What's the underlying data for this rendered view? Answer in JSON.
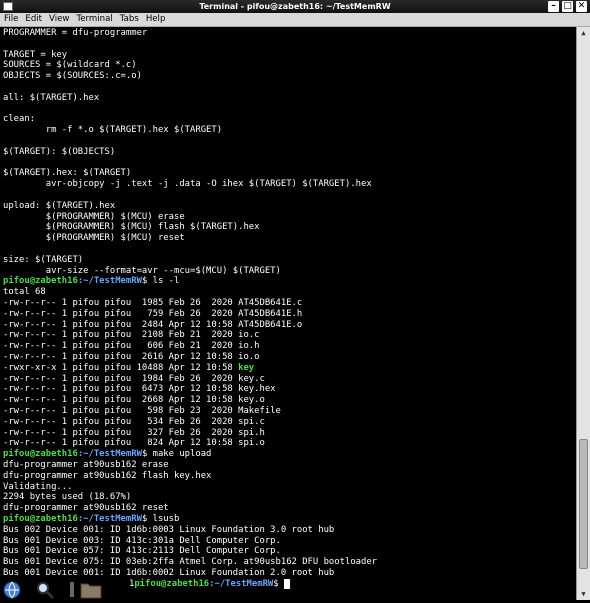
{
  "window": {
    "title": "Terminal - pifou@zabeth16: ~/TestMemRW",
    "buttons": {
      "minimize": "–",
      "maximize": "□",
      "close": "✕"
    }
  },
  "menu": [
    "File",
    "Edit",
    "View",
    "Terminal",
    "Tabs",
    "Help"
  ],
  "terminal": {
    "prompt": {
      "user_host": "pifou@zabeth16",
      "path": ":~/TestMemRW",
      "symbol": "$ "
    },
    "cut_text_on_last_line": "1",
    "lines": [
      {
        "t": "PROGRAMMER = dfu-programmer"
      },
      {
        "t": ""
      },
      {
        "t": "TARGET = key"
      },
      {
        "t": "SOURCES = $(wildcard *.c)"
      },
      {
        "t": "OBJECTS = $(SOURCES:.c=.o)"
      },
      {
        "t": ""
      },
      {
        "t": "all: $(TARGET).hex"
      },
      {
        "t": ""
      },
      {
        "t": "clean:"
      },
      {
        "t": "        rm -f *.o $(TARGET).hex $(TARGET)"
      },
      {
        "t": ""
      },
      {
        "t": "$(TARGET): $(OBJECTS)"
      },
      {
        "t": ""
      },
      {
        "t": "$(TARGET).hex: $(TARGET)"
      },
      {
        "t": "        avr-objcopy -j .text -j .data -O ihex $(TARGET) $(TARGET).hex"
      },
      {
        "t": ""
      },
      {
        "t": "upload: $(TARGET).hex"
      },
      {
        "t": "        $(PROGRAMMER) $(MCU) erase"
      },
      {
        "t": "        $(PROGRAMMER) $(MCU) flash $(TARGET).hex"
      },
      {
        "t": "        $(PROGRAMMER) $(MCU) reset"
      },
      {
        "t": ""
      },
      {
        "t": "size: $(TARGET)"
      },
      {
        "t": "        avr-size --format=avr --mcu=$(MCU) $(TARGET)"
      },
      {
        "t": "ls -l",
        "prompt": true
      },
      {
        "t": "total 68"
      },
      {
        "t": "-rw-r--r-- 1 pifou pifou  1985 Feb 26  2020 AT45DB641E.c"
      },
      {
        "t": "-rw-r--r-- 1 pifou pifou   759 Feb 26  2020 AT45DB641E.h"
      },
      {
        "t": "-rw-r--r-- 1 pifou pifou  2484 Apr 12 10:58 AT45DB641E.o"
      },
      {
        "t": "-rw-r--r-- 1 pifou pifou  2108 Feb 21  2020 io.c"
      },
      {
        "t": "-rw-r--r-- 1 pifou pifou   606 Feb 21  2020 io.h"
      },
      {
        "t": "-rw-r--r-- 1 pifou pifou  2616 Apr 12 10:58 io.o"
      },
      {
        "t": "-rwxr-xr-x 1 pifou pifou 10488 Apr 12 10:58 ",
        "exe": "key"
      },
      {
        "t": "-rw-r--r-- 1 pifou pifou  1984 Feb 26  2020 key.c"
      },
      {
        "t": "-rw-r--r-- 1 pifou pifou  6473 Apr 12 10:58 key.hex"
      },
      {
        "t": "-rw-r--r-- 1 pifou pifou  2668 Apr 12 10:58 key.o"
      },
      {
        "t": "-rw-r--r-- 1 pifou pifou   598 Feb 23  2020 Makefile"
      },
      {
        "t": "-rw-r--r-- 1 pifou pifou   534 Feb 26  2020 spi.c"
      },
      {
        "t": "-rw-r--r-- 1 pifou pifou   327 Feb 26  2020 spi.h"
      },
      {
        "t": "-rw-r--r-- 1 pifou pifou   824 Apr 12 10:58 spi.o"
      },
      {
        "t": "make upload",
        "prompt": true
      },
      {
        "t": "dfu-programmer at90usb162 erase"
      },
      {
        "t": "dfu-programmer at90usb162 flash key.hex"
      },
      {
        "t": "Validating..."
      },
      {
        "t": "2294 bytes used (18.67%)"
      },
      {
        "t": "dfu-programmer at90usb162 reset"
      },
      {
        "t": "lsusb",
        "prompt": true
      },
      {
        "t": "Bus 002 Device 001: ID 1d6b:0003 Linux Foundation 3.0 root hub"
      },
      {
        "t": "Bus 001 Device 003: ID 413c:301a Dell Computer Corp."
      },
      {
        "t": "Bus 001 Device 057: ID 413c:2113 Dell Computer Corp."
      },
      {
        "t": "Bus 001 Device 075: ID 03eb:2ffa Atmel Corp. at90usb162 DFU bootloader"
      },
      {
        "t": "Bus 001 Device 001: ID 1d6b:0002 Linux Foundation 2.0 root hub"
      }
    ]
  },
  "taskbar": [
    "browser-icon",
    "search-icon",
    "files-icon"
  ],
  "colors": {
    "prompt_user": "#4ddd4d",
    "prompt_path": "#6aa5ff",
    "executable": "#4ddd4d",
    "background": "#000000"
  }
}
